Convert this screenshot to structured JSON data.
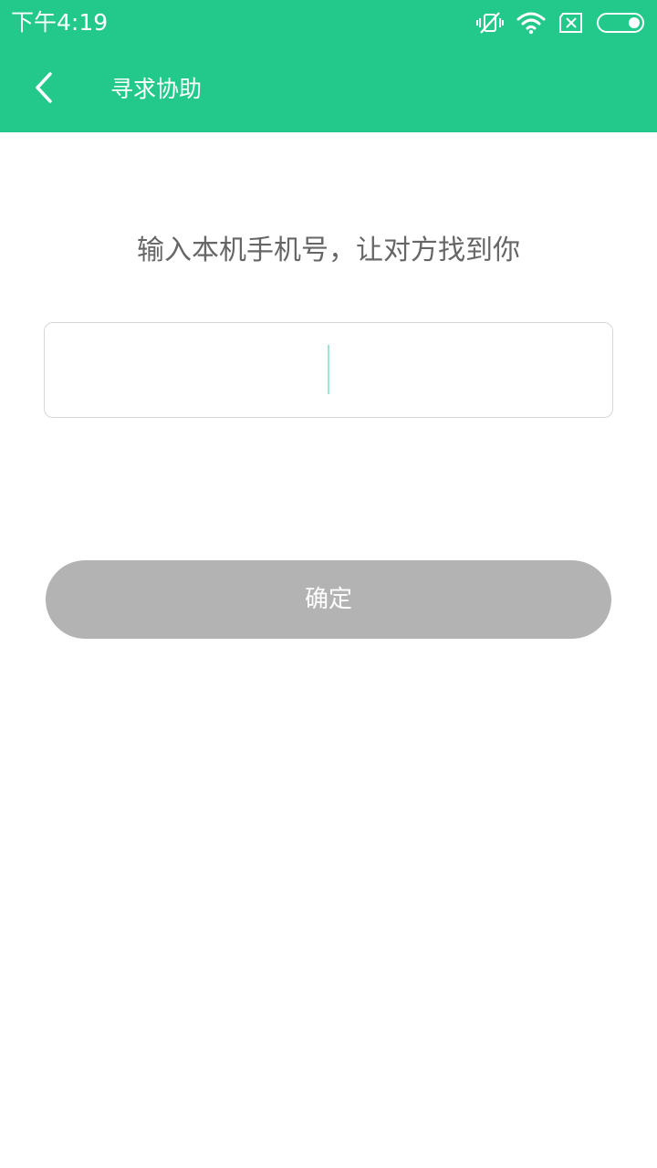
{
  "status_bar": {
    "time": "下午4:19",
    "icons": [
      "vibrate-off-icon",
      "wifi-icon",
      "no-sim-icon",
      "battery-icon"
    ]
  },
  "header": {
    "title": "寻求协助",
    "back_icon": "chevron-left-icon"
  },
  "main": {
    "prompt": "输入本机手机号，让对方找到你",
    "phone_input": {
      "value": "",
      "placeholder": ""
    },
    "confirm_label": "确定"
  },
  "colors": {
    "accent": "#23c98a",
    "button_disabled": "#b3b3b3",
    "prompt_text": "#666666",
    "input_border": "#d6d6d6"
  }
}
